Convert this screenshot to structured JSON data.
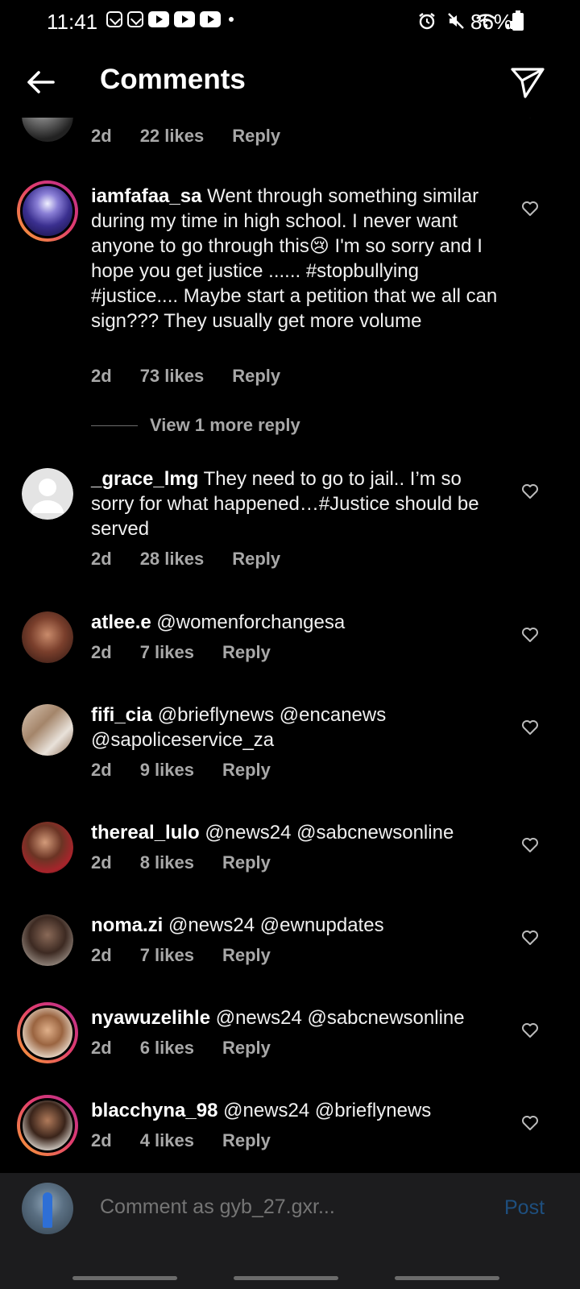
{
  "status_bar": {
    "time": "11:41",
    "battery": "86%",
    "icons": [
      "download-icon",
      "download-icon",
      "youtube-icon",
      "youtube-icon",
      "youtube-icon",
      "alarm-icon",
      "mute-icon",
      "wifi-icon",
      "signal-icon",
      "battery-icon"
    ]
  },
  "header": {
    "title": "Comments"
  },
  "top_partial": {
    "time": "2d",
    "likes": "22 likes",
    "reply": "Reply"
  },
  "comments": [
    {
      "username": "iamfafaa_sa",
      "text": "Went through something similar during my time in high school. I never want anyone to go through this😢 I'm so sorry and I hope you get justice ...... #stopbullying #justice.... Maybe start a petition that we all can sign??? They usually get more volume",
      "time": "2d",
      "likes": "73 likes",
      "reply": "Reply",
      "view_more": "View 1 more reply"
    },
    {
      "username": "_grace_lmg",
      "text": "They need to go to jail.. I’m so sorry for what happened…#Justice should be served",
      "time": "2d",
      "likes": "28 likes",
      "reply": "Reply"
    },
    {
      "username": "atlee.e",
      "text": "@womenforchangesa",
      "time": "2d",
      "likes": "7 likes",
      "reply": "Reply"
    },
    {
      "username": "fifi_cia",
      "text": "@brieflynews @encanews @sapoliceservice_za",
      "time": "2d",
      "likes": "9 likes",
      "reply": "Reply"
    },
    {
      "username": "thereal_lulo",
      "text": "@news24 @sabcnewsonline",
      "time": "2d",
      "likes": "8 likes",
      "reply": "Reply"
    },
    {
      "username": "noma.zi",
      "text": "@news24 @ewnupdates",
      "time": "2d",
      "likes": "7 likes",
      "reply": "Reply"
    },
    {
      "username": "nyawuzelihle",
      "text": "@news24 @sabcnewsonline",
      "time": "2d",
      "likes": "6 likes",
      "reply": "Reply"
    },
    {
      "username": "blacchyna_98",
      "text": "@news24 @brieflynews",
      "time": "2d",
      "likes": "4 likes",
      "reply": "Reply"
    }
  ],
  "composer": {
    "placeholder": "Comment as gyb_27.gxr...",
    "post_label": "Post"
  },
  "colors": {
    "background": "#000000",
    "secondary_text": "#a8a8a8",
    "post_disabled": "#1e4f7f",
    "story_ring_start": "#f9a233",
    "story_ring_end": "#b52c8f"
  }
}
